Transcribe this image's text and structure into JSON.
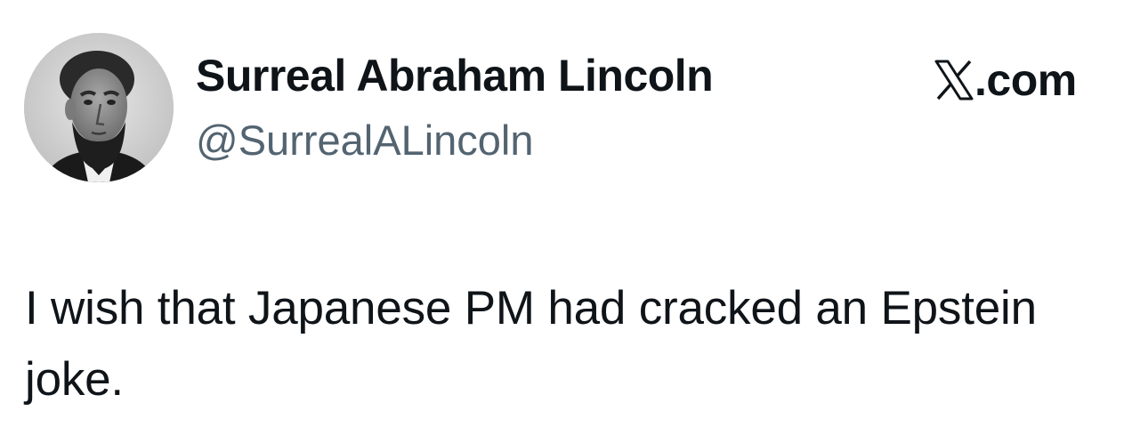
{
  "author": {
    "display_name": "Surreal Abraham Lincoln",
    "handle": "@SurrealALincoln",
    "avatar_icon": "portrait-avatar"
  },
  "brand": {
    "icon": "x-logo-icon",
    "domain_suffix": ".com"
  },
  "tweet": {
    "text": "I wish that Japanese PM had cracked an Epstein joke."
  },
  "colors": {
    "primary_text": "#0f1419",
    "secondary_text": "#536471",
    "background": "#ffffff"
  }
}
